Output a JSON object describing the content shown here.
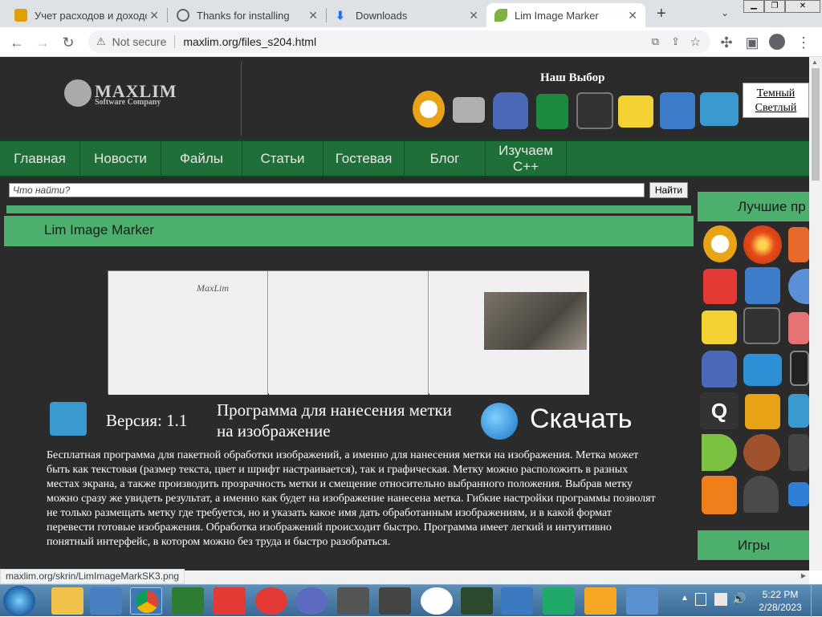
{
  "browser": {
    "tabs": [
      {
        "title": "Учет расходов и доходов",
        "active": false
      },
      {
        "title": "Thanks for installing",
        "active": false
      },
      {
        "title": "Downloads",
        "active": false
      },
      {
        "title": "Lim Image Marker",
        "active": true
      }
    ],
    "security_label": "Not secure",
    "url": "maxlim.org/files_s204.html",
    "new_tab": "+"
  },
  "site": {
    "logo_name": "MAXLIM",
    "logo_sub": "Software Company",
    "our_choice": "Наш Выбор",
    "theme_dark": "Темный",
    "theme_light": "Светлый",
    "nav": [
      "Главная",
      "Новости",
      "Файлы",
      "Статьи",
      "Гостевая",
      "Блог",
      "Изучаем C++"
    ],
    "search_placeholder": "Что найти?",
    "search_button": "Найти",
    "page_heading": "Lim Image Marker",
    "version": "Версия: 1.1",
    "program_title": "Программа для нанесения метки на изображение",
    "download": "Скачать",
    "screenshot_watermark": "MaxLim",
    "description": "Бесплатная программа для пакетной обработки изображений, а именно для нанесения метки на изображения. Метка может быть как текстовая (размер текста, цвет и шрифт настраивается), так и графическая. Метку можно расположить в разных местах экрана, а также производить прозрачность метки и смещение относительно выбранного положения. Выбрав метку можно сразу же увидеть результат, а именно как будет на изображение нанесена метка. Гибкие настройки программы позволят не только размещать метку где требуется, но и указать какое имя дать обработанным изображениям, и в какой формат перевести готовые изображения. Обработка изображений происходит быстро. Программа имеет легкий и интуитивно понятный интерфейс, в котором можно без труда и быстро разобраться.",
    "sidebar_best": "Лучшие пр",
    "sidebar_games": "Игры"
  },
  "status_url": "maxlim.org/skrin/LimImageMarkSK3.png",
  "taskbar": {
    "time": "5:22 PM",
    "date": "2/28/2023"
  },
  "colors": {
    "page_bg": "#2b2b2b",
    "nav_green": "#1f6f38",
    "heading_green": "#4caf6e"
  }
}
